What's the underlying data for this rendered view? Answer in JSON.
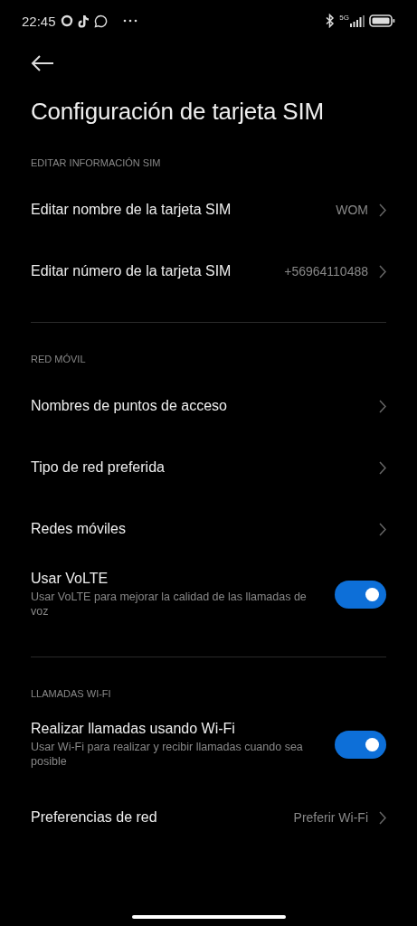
{
  "status_bar": {
    "time": "22:45",
    "network": "5G"
  },
  "title": "Configuración de tarjeta SIM",
  "sections": [
    {
      "header": "EDITAR INFORMACIÓN SIM",
      "items": [
        {
          "kind": "link",
          "label": "Editar nombre de la tarjeta SIM",
          "value": "WOM"
        },
        {
          "kind": "link",
          "label": "Editar número de la tarjeta SIM",
          "value": "+56964110488"
        }
      ]
    },
    {
      "header": "RED MÓVIL",
      "items": [
        {
          "kind": "link",
          "label": "Nombres de puntos de acceso"
        },
        {
          "kind": "link",
          "label": "Tipo de red preferida"
        },
        {
          "kind": "link",
          "label": "Redes móviles"
        },
        {
          "kind": "toggle",
          "label": "Usar VoLTE",
          "description": "Usar VoLTE para mejorar la calidad de las llamadas de voz",
          "on": true
        }
      ]
    },
    {
      "header": "LLAMADAS WI-FI",
      "items": [
        {
          "kind": "toggle",
          "label": "Realizar llamadas usando Wi-Fi",
          "description": "Usar Wi-Fi para realizar y recibir llamadas cuando sea posible",
          "on": true
        },
        {
          "kind": "link",
          "label": "Preferencias de red",
          "value": "Preferir Wi-Fi"
        }
      ]
    }
  ]
}
